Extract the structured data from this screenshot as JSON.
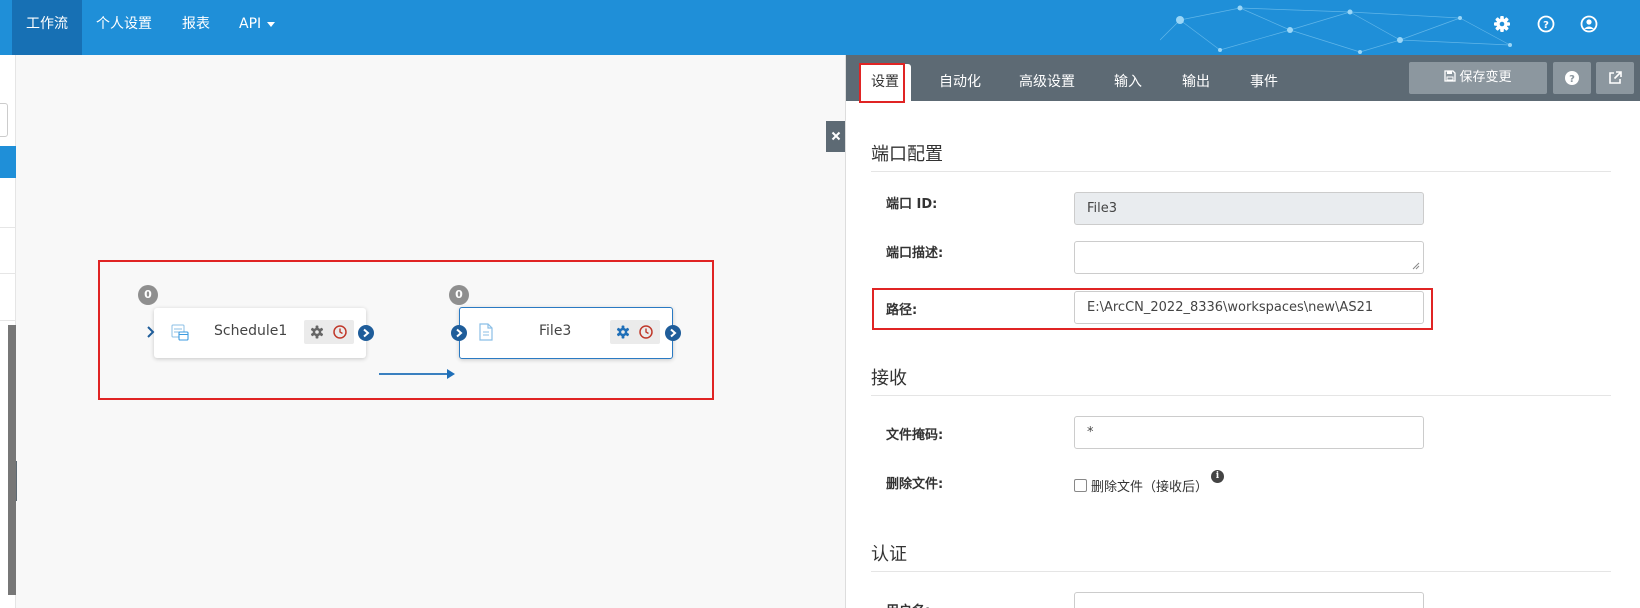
{
  "nav": {
    "items": [
      {
        "label": "工作流",
        "active": true
      },
      {
        "label": "个人设置",
        "active": false
      },
      {
        "label": "报表",
        "active": false
      },
      {
        "label": "API",
        "active": false
      }
    ],
    "icons": [
      "gear-icon",
      "help-icon",
      "user-icon"
    ]
  },
  "canvas": {
    "nodes": [
      {
        "name": "Schedule1",
        "badge": "0",
        "icon": "schedule-icon"
      },
      {
        "name": "File3",
        "badge": "0",
        "icon": "file-icon"
      }
    ]
  },
  "panel": {
    "tabs": [
      {
        "label": "设置",
        "active": true
      },
      {
        "label": "自动化",
        "active": false
      },
      {
        "label": "高级设置",
        "active": false
      },
      {
        "label": "输入",
        "active": false
      },
      {
        "label": "输出",
        "active": false
      },
      {
        "label": "事件",
        "active": false
      }
    ],
    "save_label": "保存变更",
    "sections": {
      "port_config": "端口配置",
      "receive": "接收",
      "auth": "认证"
    },
    "fields": {
      "port_id_label": "端口 ID:",
      "port_id_value": "File3",
      "port_desc_label": "端口描述:",
      "port_desc_value": "",
      "path_label": "路径:",
      "path_value": "E:\\ArcCN_2022_8336\\workspaces\\new\\AS21",
      "mask_label": "文件掩码:",
      "mask_value": "*",
      "delete_label": "删除文件:",
      "delete_checkbox_label": "删除文件（接收后）",
      "delete_checked": false,
      "username_label": "用户名:"
    }
  },
  "colors": {
    "nav_bg": "#1f8fd8",
    "nav_active": "#1770b4",
    "tabbar_bg": "#5d6a74",
    "highlight": "#e02424",
    "port": "#1f5d9a",
    "clock": "#c0392b",
    "gear_active": "#1f6fb8"
  }
}
